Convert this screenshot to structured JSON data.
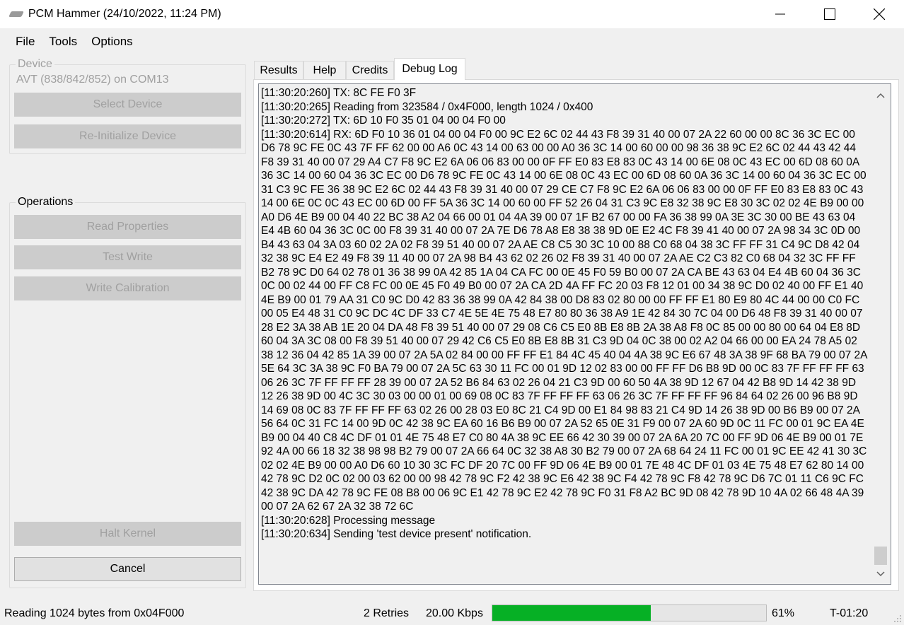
{
  "window": {
    "title": "PCM Hammer (24/10/2022, 11:24 PM)",
    "icon": "chip-icon",
    "controls": [
      "minimize-icon",
      "maximize-icon",
      "close-icon"
    ]
  },
  "menu": [
    "File",
    "Tools",
    "Options"
  ],
  "device": {
    "group_label": "Device",
    "status": "AVT (838/842/852) on COM13",
    "select_button": "Select Device",
    "reinit_button": "Re-Initialize Device"
  },
  "operations": {
    "group_label": "Operations",
    "read_properties": "Read Properties",
    "test_write": "Test Write",
    "write_calibration": "Write Calibration"
  },
  "halt_kernel": "Halt Kernel",
  "cancel": "Cancel",
  "tabs": [
    {
      "label": "Results",
      "active": false
    },
    {
      "label": "Help",
      "active": false
    },
    {
      "label": "Credits",
      "active": false
    },
    {
      "label": "Debug Log",
      "active": true
    }
  ],
  "log": [
    "[11:30:20:260]  TX: 8C FE F0 3F",
    "[11:30:20:265]  Reading from 323584 / 0x4F000, length 1024 / 0x400",
    "[11:30:20:272]  TX: 6D 10 F0 35 01 04 00 04 F0 00",
    "[11:30:20:614]  RX: 6D F0 10 36 01 04 00 04 F0 00 9C E2 6C 02 44 43 F8 39 31 40 00 07 2A 22 60 00 00 8C 36 3C EC 00 D6 78 9C FE 0C 43 7F FF 62 00 00 A6 0C 43 14 00 63 00 00 A0 36 3C 14 00 60 00 00 98 36 38 9C E2 6C 02 44 43 42 44 F8 39 31 40 00 07 29 A4 C7 F8 9C E2 6A 06 06 83 00 00 0F FF E0 83 E8 83 0C 43 14 00 6E 08 0C 43 EC 00 6D 08 60 0A 36 3C 14 00 60 04 36 3C EC 00 D6 78 9C FE 0C 43 14 00 6E 08 0C 43 EC 00 6D 08 60 0A 36 3C 14 00 60 04 36 3C EC 00 31 C3 9C FE 36 38 9C E2 6C 02 44 43 F8 39 31 40 00 07 29 CE C7 F8 9C E2 6A 06 06 83 00 00 0F FF E0 83 E8 83 0C 43 14 00 6E 0C 0C 43 EC 00 6D 00 FF 5A 36 3C 14 00 60 00 FF 52 26 04 31 C3 9C E8 32 38 9C E8 30 3C 02 02 4E B9 00 00 A0 D6 4E B9 00 04 40 22 BC 38 A2 04 66 00 01 04 4A 39 00 07 1F B2 67 00 00 FA 36 38 99 0A 3E 3C 30 00 BE 43 63 04 E4 4B 60 04 36 3C 0C 00 F8 39 31 40 00 07 2A 7E D6 78 A8 E8 38 38 9D 0E E2 4C F8 39 41 40 00 07 2A 98 34 3C 0D 00 B4 43 63 04 3A 03 60 02 2A 02 F8 39 51 40 00 07 2A AE C8 C5 30 3C 10 00 88 C0 68 04 38 3C FF FF 31 C4 9C D8 42 04 32 38 9C E4 E2 49 F8 39 11 40 00 07 2A 98 B4 43 62 02 26 02 F8 39 31 40 00 07 2A AE C2 C3 82 C0 68 04 32 3C FF FF B2 78 9C D0 64 02 78 01 36 38 99 0A 42 85 1A 04 CA FC 00 0E 45 F0 59 B0 00 07 2A CA BE 43 63 04 E4 4B 60 04 36 3C 0C 00 02 44 00 FF C8 FC 00 0E 45 F0 49 B0 00 07 2A CA 2D 4A FF FC 20 03 F8 12 01 00 34 38 9C D0 02 40 00 FF E1 40 4E B9 00 01 79 AA 31 C0 9C D0 42 83 36 38 99 0A 42 84 38 00 D8 83 02 80 00 00 FF FF E1 80 E9 80 4C 44 00 00 C0 FC 00 05 E4 48 31 C0 9C DC 4C DF 33 C7 4E 5E 4E 75 48 E7 80 80 36 38 A9 1E 42 84 30 7C 04 00 D6 48 F8 39 31 40 00 07 28 E2 3A 38 AB 1E 20 04 DA 48 F8 39 51 40 00 07 29 08 C6 C5 E0 8B E8 8B 2A 38 A8 F8 0C 85 00 00 80 00 64 04 E8 8D 60 04 3A 3C 08 00 F8 39 51 40 00 07 29 42 C6 C5 E0 8B E8 8B 31 C3 9D 04 0C 38 00 02 A2 04 66 00 00 EA 24 78 A5 02 38 12 36 04 42 85 1A 39 00 07 2A 5A 02 84 00 00 FF FF E1 84 4C 45 40 04 4A 38 9C E6 67 48 3A 38 9F 68 BA 79 00 07 2A 5E 64 3C 3A 38 9C F0 BA 79 00 07 2A 5C 63 30 11 FC 00 01 9D 12 02 83 00 00 FF FF D6 B8 9D 00 0C 83 7F FF FF FF 63 06 26 3C 7F FF FF FF 28 39 00 07 2A 52 B6 84 63 02 26 04 21 C3 9D 00 60 50 4A 38 9D 12 67 04 42 B8 9D 14 42 38 9D 12 26 38 9D 00 4C 3C 30 03 00 00 01 00 69 08 0C 83 7F FF FF FF 63 06 26 3C 7F FF FF FF 96 84 64 02 26 00 96 B8 9D 14 69 08 0C 83 7F FF FF FF 63 02 26 00 28 03 E0 8C 21 C4 9D 00 E1 84 98 83 21 C4 9D 14 26 38 9D 00 B6 B9 00 07 2A 56 64 0C 31 FC 14 00 9D 0C 42 38 9C EA 60 16 B6 B9 00 07 2A 52 65 0E 31 F9 00 07 2A 60 9D 0C 11 FC 00 01 9C EA 4E B9 00 04 40 C8 4C DF 01 01 4E 75 48 E7 C0 80 4A 38 9C EE 66 42 30 39 00 07 2A 6A 20 7C 00 FF 9D 06 4E B9 00 01 7E 92 4A 00 66 18 32 38 98 98 B2 79 00 07 2A 66 64 0C 32 38 A8 30 B2 79 00 07 2A 68 64 24 11 FC 00 01 9C EE 42 41 30 3C 02 02 4E B9 00 00 A0 D6 60 10 30 3C FC DF 20 7C 00 FF 9D 06 4E B9 00 01 7E 48 4C DF 01 03 4E 75 48 E7 62 80 14 00 42 78 9C D2 0C 02 00 03 62 00 00 98 42 78 9C F2 42 38 9C E6 42 38 9C F4 42 78 9C F8 42 78 9C D6 7C 01 11 C6 9C FC 42 38 9C DA 42 78 9C FE 08 B8 00 06 9C E1 42 78 9C E2 42 78 9C F0 31 F8 A2 BC 9D 08 42 78 9D 10 4A 02 66 48 4A 39 00 07 2A 62 67 2A 32 38 72 6C",
    "[11:30:20:628]  Processing message",
    "[11:30:20:634]  Sending 'test device present' notification."
  ],
  "status": {
    "message": "Reading 1024 bytes from 0x04F000",
    "retries": "2 Retries",
    "speed": "20.00 Kbps",
    "progress_fraction": 0.58,
    "percent": "61%",
    "time": "T-01:20"
  }
}
